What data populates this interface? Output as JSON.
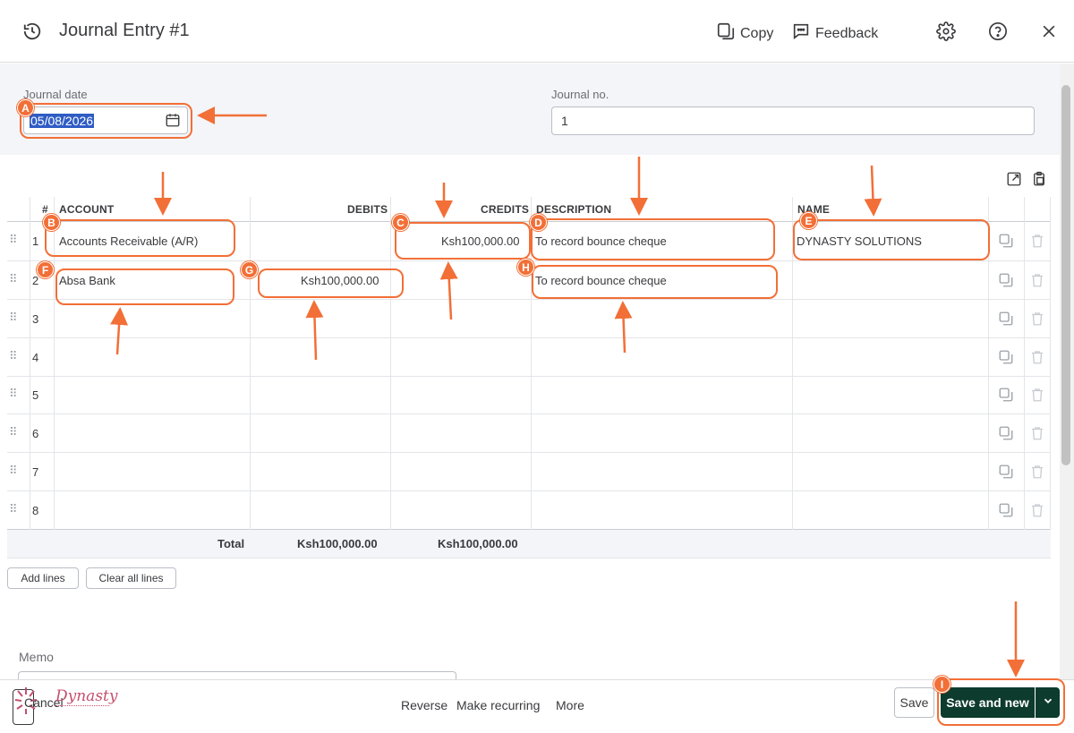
{
  "header": {
    "title": "Journal Entry #1",
    "copy_label": "Copy",
    "feedback_label": "Feedback"
  },
  "form": {
    "journal_date_label": "Journal date",
    "journal_date_value": "05/08/2026",
    "journal_no_label": "Journal no.",
    "journal_no_value": "1"
  },
  "table": {
    "columns": [
      "#",
      "ACCOUNT",
      "DEBITS",
      "CREDITS",
      "DESCRIPTION",
      "NAME"
    ],
    "rows": [
      {
        "num": "1",
        "account": "Accounts Receivable (A/R)",
        "debit": "",
        "credit": "Ksh100,000.00",
        "description": "To record bounce cheque",
        "name": "DYNASTY SOLUTIONS"
      },
      {
        "num": "2",
        "account": "Absa Bank",
        "debit": "Ksh100,000.00",
        "credit": "",
        "description": "To record bounce cheque",
        "name": ""
      },
      {
        "num": "3",
        "account": "",
        "debit": "",
        "credit": "",
        "description": "",
        "name": ""
      },
      {
        "num": "4",
        "account": "",
        "debit": "",
        "credit": "",
        "description": "",
        "name": ""
      },
      {
        "num": "5",
        "account": "",
        "debit": "",
        "credit": "",
        "description": "",
        "name": ""
      },
      {
        "num": "6",
        "account": "",
        "debit": "",
        "credit": "",
        "description": "",
        "name": ""
      },
      {
        "num": "7",
        "account": "",
        "debit": "",
        "credit": "",
        "description": "",
        "name": ""
      },
      {
        "num": "8",
        "account": "",
        "debit": "",
        "credit": "",
        "description": "",
        "name": ""
      }
    ],
    "total_label": "Total",
    "total_debits": "Ksh100,000.00",
    "total_credits": "Ksh100,000.00",
    "add_lines_label": "Add lines",
    "clear_lines_label": "Clear all lines"
  },
  "memo": {
    "label": "Memo"
  },
  "footer": {
    "cancel_label": "Cancel",
    "reverse_label": "Reverse",
    "make_recurring_label": "Make recurring",
    "more_label": "More",
    "save_label": "Save",
    "save_and_new_label": "Save and new",
    "logo_text": "Dynasty"
  },
  "annotations": {
    "badges": [
      "A",
      "B",
      "C",
      "D",
      "E",
      "F",
      "G",
      "H",
      "I"
    ],
    "color": "#f26f37"
  },
  "colors": {
    "primary_button": "#0d3b2e",
    "annotation": "#f26f37",
    "selection": "#2f5cc4"
  },
  "icons": [
    "history-icon",
    "copy-icon",
    "feedback-icon",
    "gear-icon",
    "help-icon",
    "close-icon",
    "calendar-icon",
    "export-icon",
    "paste-icon",
    "drag-icon",
    "duplicate-icon",
    "trash-icon",
    "chevron-down-icon"
  ]
}
